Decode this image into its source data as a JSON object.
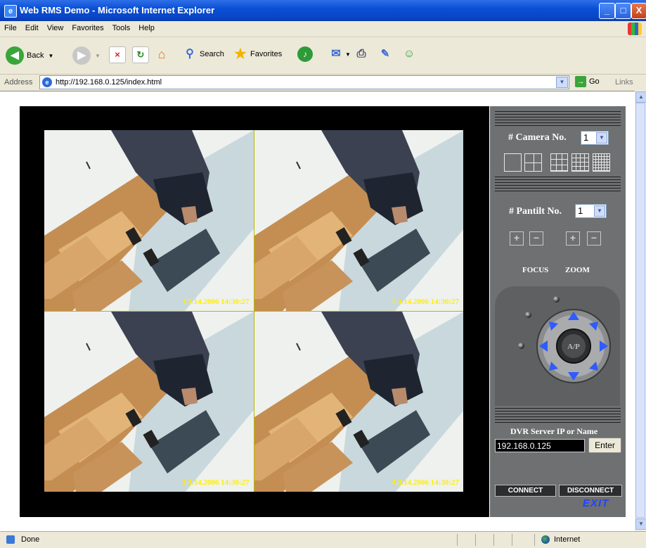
{
  "window": {
    "title": "Web RMS Demo - Microsoft Internet Explorer",
    "minimize": "_",
    "maximize": "□",
    "close": "X"
  },
  "menu": {
    "items": [
      "File",
      "Edit",
      "View",
      "Favorites",
      "Tools",
      "Help"
    ]
  },
  "toolbar": {
    "back": "Back",
    "search": "Search",
    "favorites": "Favorites"
  },
  "address": {
    "label": "Address",
    "url": "http://192.168.0.125/index.html",
    "go": "Go",
    "links": "Links"
  },
  "cameras": [
    {
      "timestamp": "1  3.14.2006 14:30:27"
    },
    {
      "timestamp": "2  3.14.2006 14:30:27"
    },
    {
      "timestamp": "3  3.14.2006 14:30:27"
    },
    {
      "timestamp": "4  3.14.2006 14:30:27"
    }
  ],
  "panel": {
    "camera_label": "# Camera No.",
    "camera_value": "1",
    "pantilt_label": "# Pantilt No.",
    "pantilt_value": "1",
    "focus_label": "FOCUS",
    "zoom_label": "ZOOM",
    "ptz_center": "A/P",
    "server_label": "DVR Server IP or Name",
    "server_ip": "192.168.0.125",
    "enter": "Enter",
    "connect": "CONNECT",
    "disconnect": "DISCONNECT",
    "exit": "EXIT"
  },
  "status": {
    "text": "Done",
    "zone": "Internet"
  },
  "colors": {
    "titlebar": "#0a4fd6",
    "panel": "#6e7071",
    "ptz_arrows": "#2f5bff",
    "timestamp": "#ffee00",
    "exit": "#2343ff"
  }
}
